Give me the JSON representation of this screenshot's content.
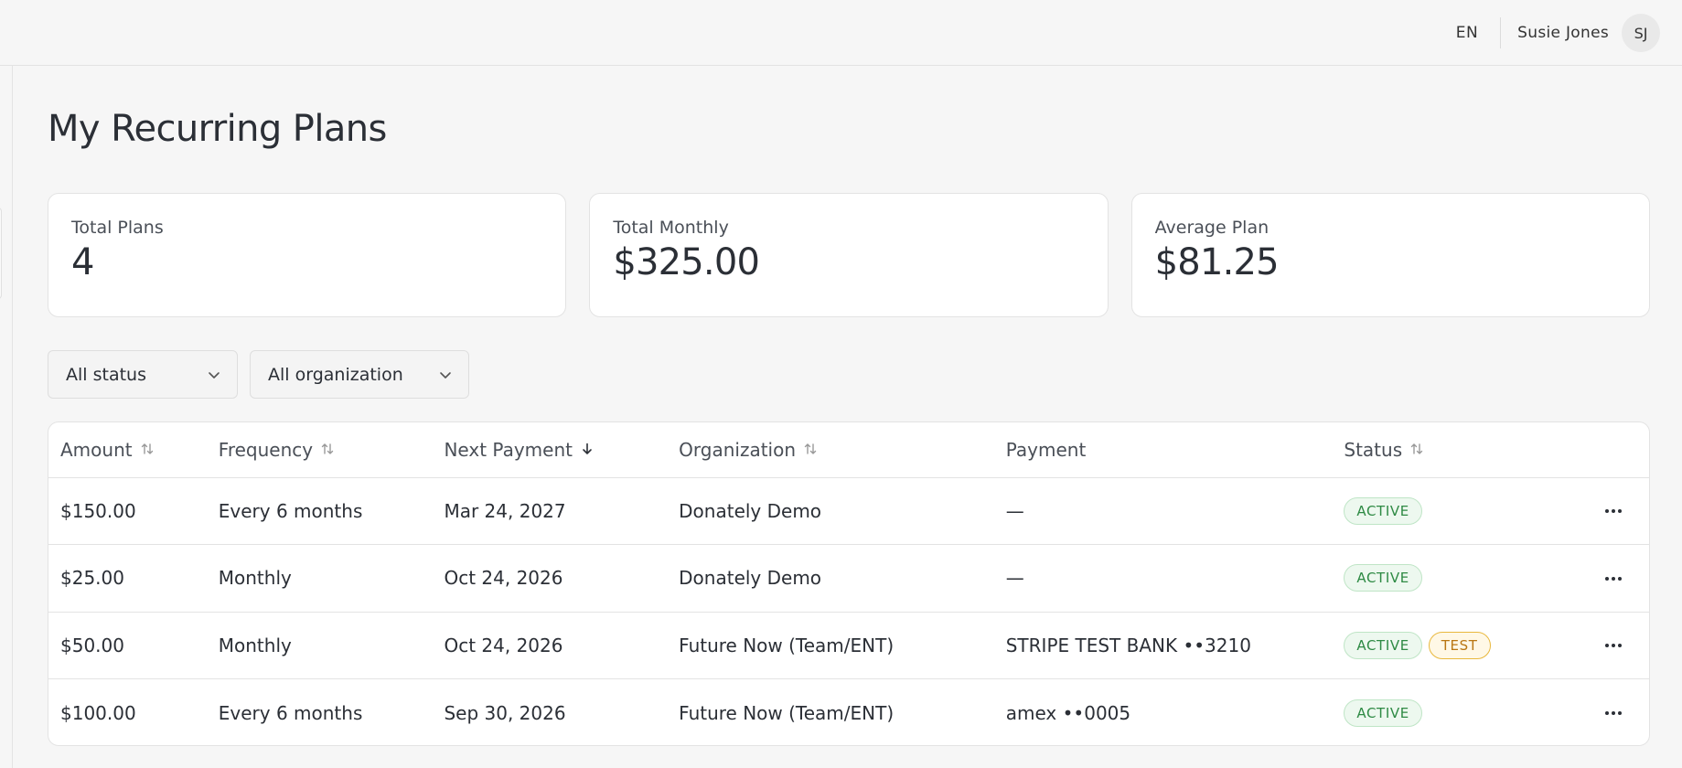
{
  "header": {
    "language": "EN",
    "user_name": "Susie Jones",
    "user_initials": "SJ"
  },
  "page": {
    "title": "My Recurring Plans"
  },
  "stats": [
    {
      "label": "Total Plans",
      "value": "4"
    },
    {
      "label": "Total Monthly",
      "value": "$325.00"
    },
    {
      "label": "Average Plan",
      "value": "$81.25"
    }
  ],
  "filters": {
    "status": "All status",
    "organization": "All organization"
  },
  "table": {
    "columns": [
      "Amount",
      "Frequency",
      "Next Payment",
      "Organization",
      "Payment",
      "Status"
    ],
    "rows": [
      {
        "amount": "$150.00",
        "frequency": "Every 6 months",
        "next_payment": "Mar 24, 2027",
        "organization": "Donately Demo",
        "payment": "—",
        "status": "ACTIVE",
        "tag": ""
      },
      {
        "amount": "$25.00",
        "frequency": "Monthly",
        "next_payment": "Oct 24, 2026",
        "organization": "Donately Demo",
        "payment": "—",
        "status": "ACTIVE",
        "tag": ""
      },
      {
        "amount": "$50.00",
        "frequency": "Monthly",
        "next_payment": "Oct 24, 2026",
        "organization": "Future Now (Team/ENT)",
        "payment": "STRIPE TEST BANK ••3210",
        "status": "ACTIVE",
        "tag": "TEST"
      },
      {
        "amount": "$100.00",
        "frequency": "Every 6 months",
        "next_payment": "Sep 30, 2026",
        "organization": "Future Now (Team/ENT)",
        "payment": "amex ••0005",
        "status": "ACTIVE",
        "tag": ""
      }
    ]
  },
  "icons": {
    "sort": "sort-icon",
    "sort_desc": "arrow-down-icon",
    "dropdown": "chevron-down-icon",
    "row_menu": "more-horizontal-icon"
  },
  "colors": {
    "active_badge": "#2e8a44",
    "test_badge": "#b97612",
    "background": "#f6f6f6"
  }
}
